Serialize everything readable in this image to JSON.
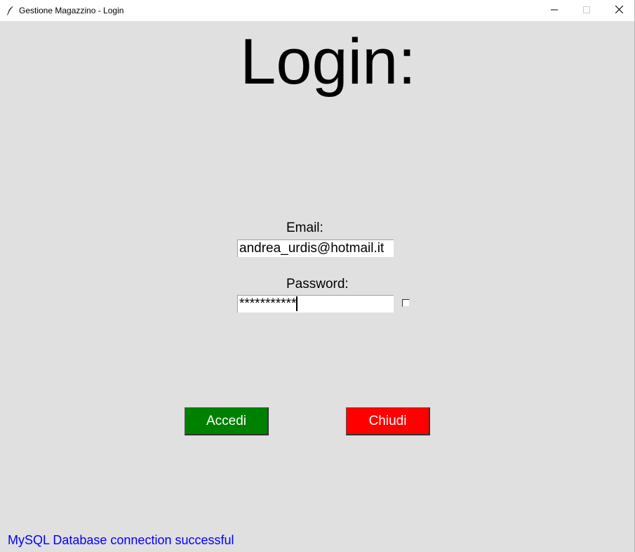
{
  "window": {
    "title": "Gestione Magazzino - Login",
    "icon": "feather-icon",
    "controls": [
      "minimize-icon",
      "maximize-icon",
      "close-icon"
    ]
  },
  "heading": "Login:",
  "form": {
    "email_label": "Email:",
    "email_value": "andrea_urdis@hotmail.it",
    "password_label": "Password:",
    "password_value": "***********"
  },
  "buttons": {
    "login_label": "Accedi",
    "close_label": "Chiudi"
  },
  "status": {
    "text": "MySQL Database connection successful",
    "color": "#0000ff"
  },
  "colors": {
    "login_button": "#008000",
    "close_button": "#ff0000",
    "background": "#e0e0e0"
  }
}
